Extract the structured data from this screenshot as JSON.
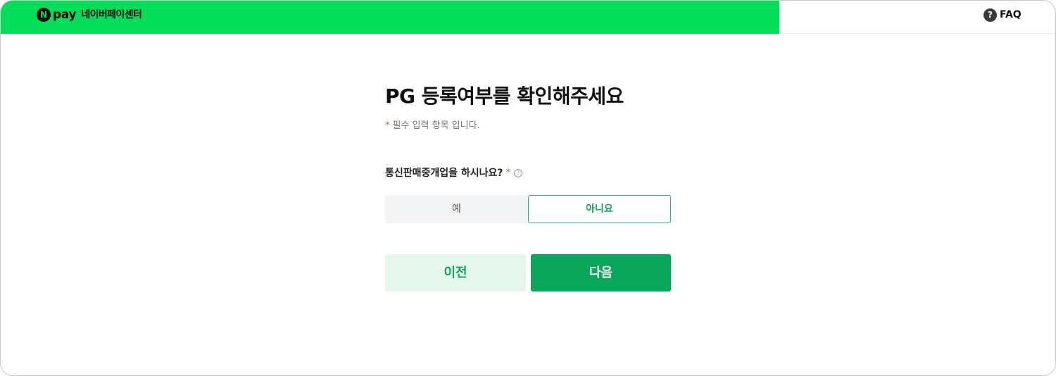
{
  "header": {
    "logo_mark": "N",
    "logo_pay": "pay",
    "center_name": "네이버페이센터",
    "faq_icon": "?",
    "faq_label": "FAQ"
  },
  "main": {
    "title": "PG 등록여부를 확인해주세요",
    "required_mark": "*",
    "required_note": "필수 입력 항목 입니다.",
    "question": "통신판매중개업을 하시나요?",
    "question_required_mark": "*",
    "help_icon": "?",
    "options": {
      "yes": "예",
      "no": "아니요",
      "selected": "아니요"
    },
    "buttons": {
      "prev": "이전",
      "next": "다음"
    }
  },
  "colors": {
    "brand_green": "#03de5a",
    "accent_green": "#0aa65b",
    "required_red": "#f04e3e"
  }
}
